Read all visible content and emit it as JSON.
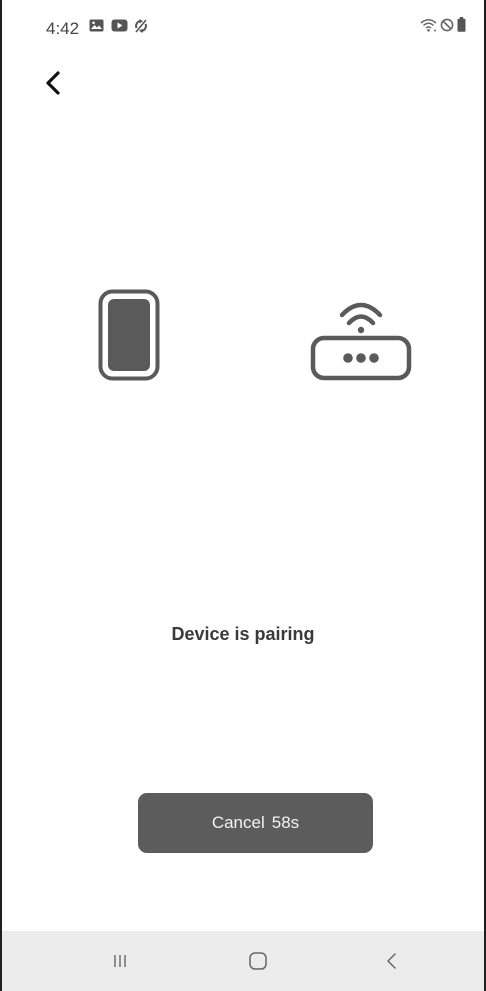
{
  "status_bar": {
    "time": "4:42",
    "left_icons": [
      "gallery-icon",
      "youtube-icon",
      "sync-icon"
    ],
    "right_icons": [
      "wifi-icon",
      "do-not-disturb-icon",
      "battery-icon"
    ]
  },
  "main": {
    "message": "Device is pairing",
    "cancel_label": "Cancel",
    "countdown": "58s"
  },
  "graphics": {
    "left": "phone-icon",
    "right": "router-wifi-icon"
  },
  "nav_bar": {
    "items": [
      "recents-icon",
      "home-icon",
      "back-icon"
    ]
  },
  "colors": {
    "icon_dark": "#5a5a5a",
    "button_bg": "#5c5c5c",
    "nav_bg": "#ececec",
    "text": "#3a3a3a"
  }
}
